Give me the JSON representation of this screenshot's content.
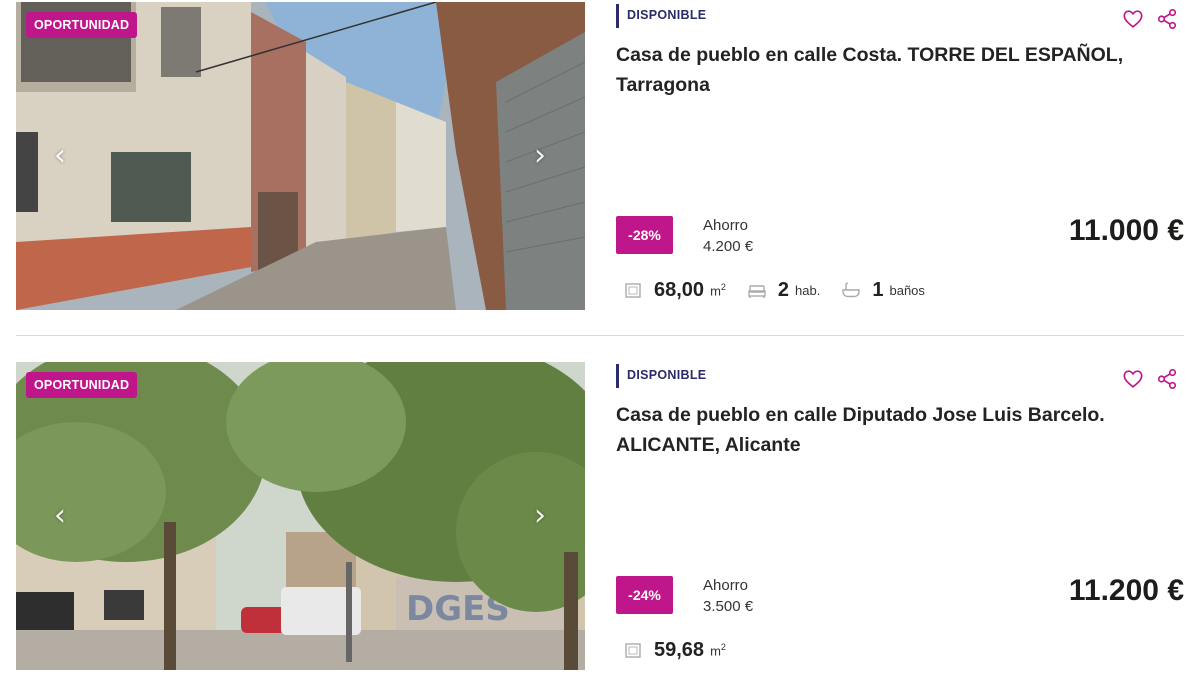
{
  "listings": [
    {
      "badge": "OPORTUNIDAD",
      "status": "DISPONIBLE",
      "title": "Casa de pueblo en calle Costa. TORRE DEL ESPAÑOL, Tarragona",
      "discount": "-28%",
      "saving_label": "Ahorro",
      "saving_value": "4.200 €",
      "price": "11.000 €",
      "area_value": "68,00",
      "area_unit": "m",
      "area_sup": "2",
      "rooms_value": "2",
      "rooms_unit": "hab.",
      "baths_value": "1",
      "baths_unit": "baños"
    },
    {
      "badge": "OPORTUNIDAD",
      "status": "DISPONIBLE",
      "title": "Casa de pueblo en calle Diputado Jose Luis Barcelo. ALICANTE, Alicante",
      "discount": "-24%",
      "saving_label": "Ahorro",
      "saving_value": "3.500 €",
      "price": "11.200 €",
      "area_value": "59,68",
      "area_unit": "m",
      "area_sup": "2"
    }
  ],
  "icons": {
    "prev": "chevron-left-icon",
    "next": "chevron-right-icon",
    "favorite": "heart-icon",
    "share": "share-icon",
    "area": "area-icon",
    "rooms": "bed-icon",
    "baths": "bathtub-icon"
  },
  "colors": {
    "accent": "#c0168b",
    "status": "#2b2a6a",
    "text": "#1d1d1b"
  }
}
